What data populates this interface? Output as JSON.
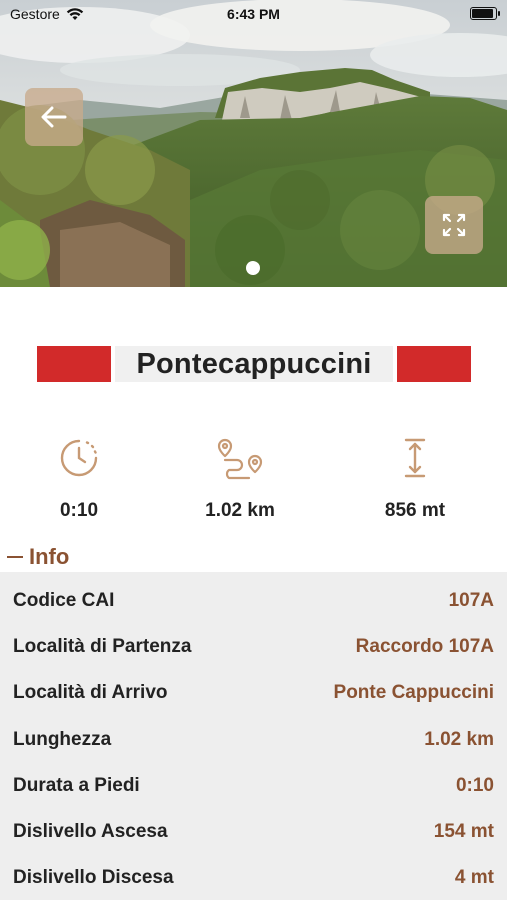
{
  "status_bar": {
    "carrier": "Gestore",
    "time": "6:43 PM"
  },
  "hero": {
    "back_icon": "arrow-left-icon",
    "expand_icon": "expand-icon",
    "page_indicator": {
      "current": 1,
      "total": 1
    }
  },
  "trail": {
    "name": "Pontecappuccini",
    "flag_color": "#d22a2a"
  },
  "stats": [
    {
      "icon": "clock-icon",
      "value": "0:10"
    },
    {
      "icon": "route-icon",
      "value": "1.02 km"
    },
    {
      "icon": "elevation-icon",
      "value": "856 mt"
    }
  ],
  "info": {
    "title": "Info",
    "rows": [
      {
        "label": "Codice CAI",
        "value": "107A"
      },
      {
        "label": "Località di Partenza",
        "value": "Raccordo 107A"
      },
      {
        "label": "Località di Arrivo",
        "value": "Ponte Cappuccini"
      },
      {
        "label": "Lunghezza",
        "value": "1.02 km"
      },
      {
        "label": "Durata a Piedi",
        "value": "0:10"
      },
      {
        "label": "Dislivello Ascesa",
        "value": "154 mt"
      },
      {
        "label": "Dislivello Discesa",
        "value": "4 mt"
      }
    ]
  },
  "colors": {
    "accent": "#8a5232",
    "icon": "#c79a74",
    "panel": "#eeeeee"
  }
}
